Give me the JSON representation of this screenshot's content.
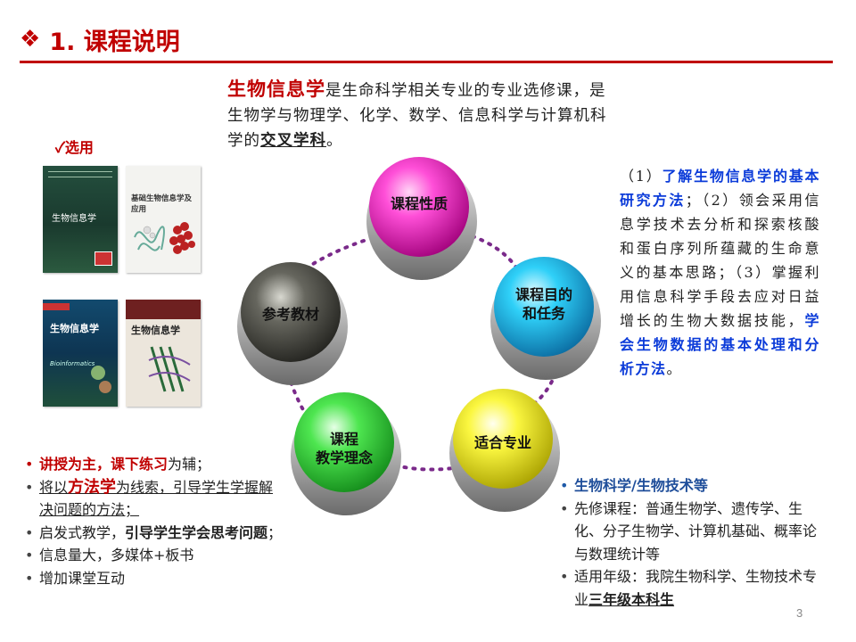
{
  "title": {
    "diamond": "❖",
    "text": "1. 课程说明"
  },
  "intro": {
    "highlight": "生物信息学",
    "line_rest": "是生命科学相关专业的专业选修课，是生物学与物理学、化学、数学、信息科学与计算机科学的",
    "emph": "交叉学科",
    "end": "。"
  },
  "selected_label": "✓选用",
  "books": [
    {
      "title": "生物信息学",
      "color": "#1f4a3a"
    },
    {
      "title": "基础生物信息学及应用",
      "color": "#f2f2f2"
    },
    {
      "title": "生物信息学",
      "subtitle": "Bioinformatics",
      "color": "#0f3e5c"
    },
    {
      "title": "生物信息学",
      "color": "#6a1f1f"
    }
  ],
  "spheres": {
    "nature": "课程性质",
    "goal_line1": "课程目的",
    "goal_line2": "和任务",
    "major": "适合专业",
    "concept_line1": "课程",
    "concept_line2": "教学理念",
    "textbook": "参考教材"
  },
  "goals": {
    "p1": "（1）",
    "b1": "了解生物信息学的基本研究方法",
    "p2": "；（2）领会采用信息学技术去分析和探索核酸和蛋白序列所蕴藏的生命意义的基本思路；（3）掌握利用信息科学手段去应对日益增长的生物大数据技能，",
    "b2": "学会生物数据的基本处理和分析方法",
    "p3": "。"
  },
  "methods": {
    "item1_bold": "讲授为主，课下练习",
    "item1_rest": "为辅；",
    "item2_pre": "将以",
    "item2_bold": "方法学",
    "item2_rest": "为线索，引导学生学握解决问题的方法；",
    "item3_pre": "启发式教学，",
    "item3_bold": "引导学生学会思考问题",
    "item3_end": "；",
    "item4": "信息量大，多媒体+板书",
    "item5": "增加课堂互动"
  },
  "majors": {
    "item1": "生物科学/生物技术等",
    "item2": "先修课程：普通生物学、遗传学、生化、分子生物学、计算机基础、概率论与数理统计等",
    "item3_pre": "适用年级：我院生物科学、生物技术专业",
    "item3_bold": "三年级本科生"
  },
  "page_number": "3",
  "colors": {
    "accent": "#c00000",
    "blue": "#0b3bd9",
    "navy": "#1f4e9a",
    "sphere_pink": "#ff2fd0",
    "sphere_cyan": "#1fc8f5",
    "sphere_yellow": "#f5f200",
    "sphere_green": "#3fe04a",
    "sphere_gray": "#4a4a44",
    "dots": "#7a2a8a"
  }
}
